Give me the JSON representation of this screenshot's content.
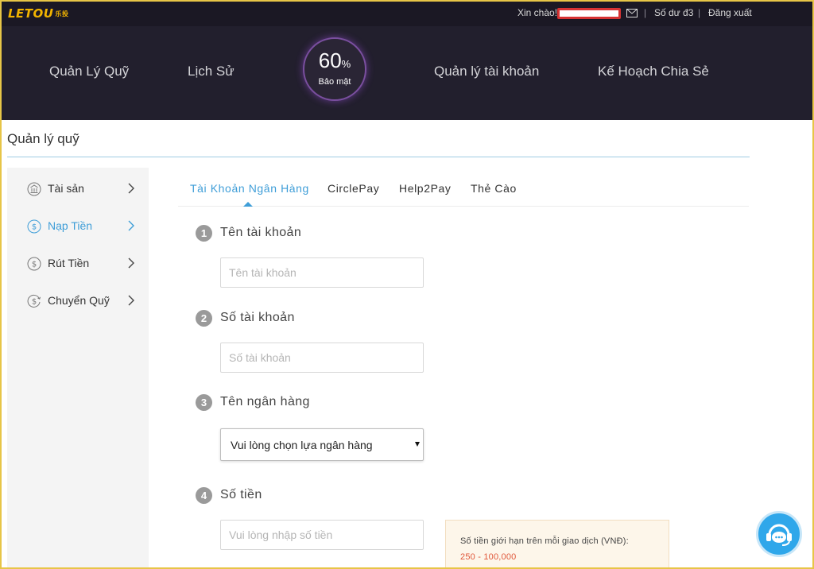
{
  "header": {
    "logo": "LETOU",
    "logo_small": "乐投",
    "greeting": "Xin chào!",
    "separator": "|",
    "balance": "Số dư đ3",
    "logout": "Đăng xuất"
  },
  "nav": {
    "items": [
      "Quản Lý Quỹ",
      "Lịch Sử",
      "Quản lý tài khoản",
      "Kế Hoạch Chia Sẻ"
    ],
    "security_percent": "60",
    "security_percent_sign": "%",
    "security_label": "Bảo mật",
    "security_ring_color": "#7a4f9f"
  },
  "page": {
    "title": "Quản lý quỹ"
  },
  "sidebar": {
    "items": [
      {
        "label": "Tài sản",
        "icon": "bank-icon",
        "active": false
      },
      {
        "label": "Nạp Tiền",
        "icon": "coin-deposit-icon",
        "active": true
      },
      {
        "label": "Rút Tiền",
        "icon": "coin-withdraw-icon",
        "active": false
      },
      {
        "label": "Chuyển Quỹ",
        "icon": "coin-transfer-icon",
        "active": false
      }
    ],
    "active_color": "#3f9ed8"
  },
  "tabs": [
    "Tài Khoản Ngân Hàng",
    "CirclePay",
    "Help2Pay",
    "Thẻ Cào"
  ],
  "form": {
    "steps": [
      {
        "num": "1",
        "label": "Tên tài khoản",
        "placeholder": "Tên tài khoản"
      },
      {
        "num": "2",
        "label": "Số tài khoản",
        "placeholder": "Số tài khoản"
      },
      {
        "num": "3",
        "label": "Tên ngân hàng",
        "select_value": "Vui lòng chọn lựa ngân hàng"
      },
      {
        "num": "4",
        "label": "Số tiền",
        "placeholder": "Vui lòng nhập số tiền"
      }
    ]
  },
  "limit_info": {
    "text": "Số tiền giới hạn trên mỗi giao dịch (VNĐ):",
    "range": "250 - 100,000",
    "range_color": "#e0583b"
  },
  "support": {
    "icon": "headset-chat-icon",
    "color": "#2fa7ea"
  }
}
